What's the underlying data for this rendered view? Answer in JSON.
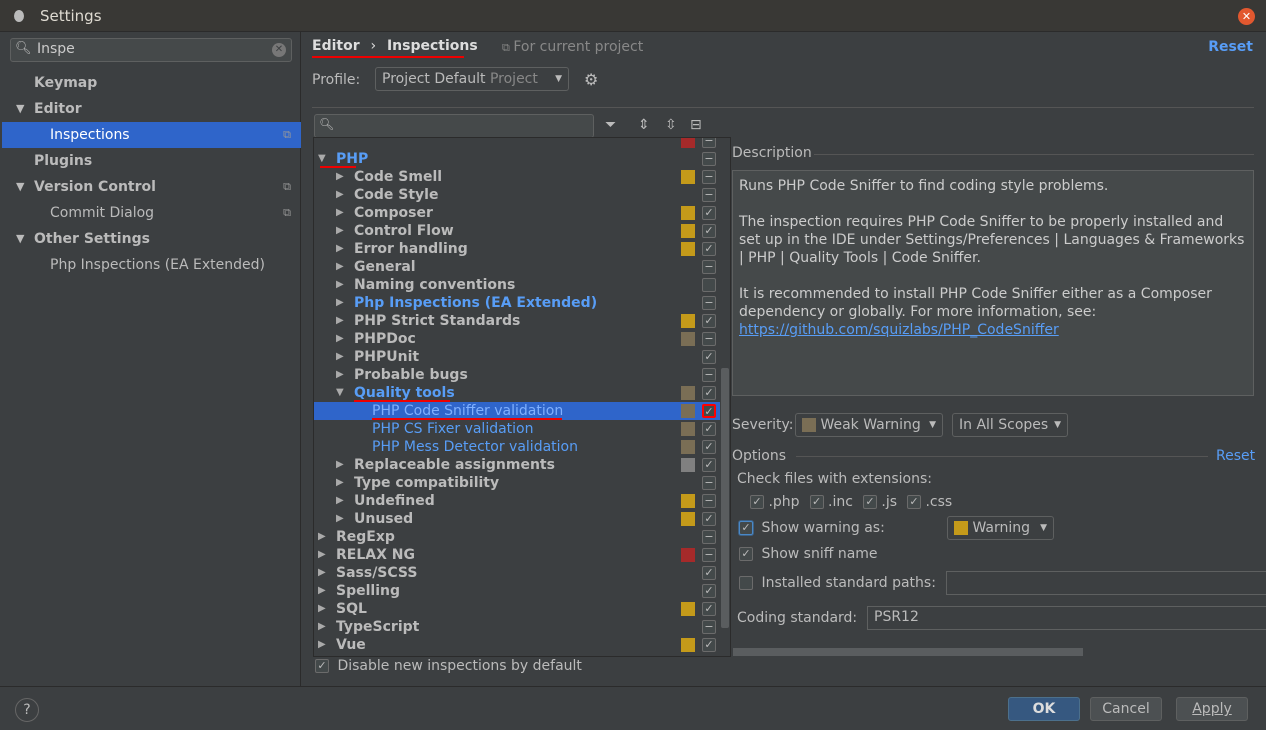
{
  "window": {
    "title": "Settings"
  },
  "search": {
    "value": "Inspe"
  },
  "sidebar": {
    "items": [
      {
        "label": "Keymap",
        "level": 0,
        "bold": true,
        "arrow": ""
      },
      {
        "label": "Editor",
        "level": 0,
        "bold": true,
        "arrow": "▼"
      },
      {
        "label": "Inspections",
        "level": 1,
        "bold": false,
        "arrow": "",
        "selected": true,
        "copy": true
      },
      {
        "label": "Plugins",
        "level": 0,
        "bold": true,
        "arrow": ""
      },
      {
        "label": "Version Control",
        "level": 0,
        "bold": true,
        "arrow": "▼",
        "copy": true
      },
      {
        "label": "Commit Dialog",
        "level": 1,
        "bold": false,
        "arrow": "",
        "copy": true
      },
      {
        "label": "Other Settings",
        "level": 0,
        "bold": true,
        "arrow": "▼"
      },
      {
        "label": "Php Inspections (EA Extended)",
        "level": 1,
        "bold": false,
        "arrow": ""
      }
    ]
  },
  "breadcrumb": {
    "parent": "Editor",
    "separator": "›",
    "current": "Inspections",
    "scope": "For current project",
    "reset": "Reset"
  },
  "profile": {
    "label": "Profile:",
    "value": "Project Default",
    "hint": "Project"
  },
  "tree": {
    "rows": [
      {
        "label": "",
        "level": 0,
        "exp": "",
        "color": "#a52a2a",
        "state": "mixed",
        "clipped": true
      },
      {
        "label": "PHP",
        "level": 0,
        "exp": "▼",
        "color": "",
        "state": "mixed",
        "bold": true,
        "blue": true
      },
      {
        "label": "Code Smell",
        "level": 1,
        "exp": "▶",
        "color": "#c49a1a",
        "state": "mixed",
        "bold": true
      },
      {
        "label": "Code Style",
        "level": 1,
        "exp": "▶",
        "color": "",
        "state": "mixed",
        "bold": true
      },
      {
        "label": "Composer",
        "level": 1,
        "exp": "▶",
        "color": "#c49a1a",
        "state": "checked",
        "bold": true
      },
      {
        "label": "Control Flow",
        "level": 1,
        "exp": "▶",
        "color": "#c49a1a",
        "state": "checked",
        "bold": true
      },
      {
        "label": "Error handling",
        "level": 1,
        "exp": "▶",
        "color": "#c49a1a",
        "state": "checked",
        "bold": true
      },
      {
        "label": "General",
        "level": 1,
        "exp": "▶",
        "color": "",
        "state": "mixed",
        "bold": true
      },
      {
        "label": "Naming conventions",
        "level": 1,
        "exp": "▶",
        "color": "",
        "state": "unchecked",
        "bold": true
      },
      {
        "label": "Php Inspections (EA Extended)",
        "level": 1,
        "exp": "▶",
        "color": "",
        "state": "mixed",
        "bold": true,
        "blue": true
      },
      {
        "label": "PHP Strict Standards",
        "level": 1,
        "exp": "▶",
        "color": "#c49a1a",
        "state": "checked",
        "bold": true
      },
      {
        "label": "PHPDoc",
        "level": 1,
        "exp": "▶",
        "color": "#7a6e55",
        "state": "mixed",
        "bold": true
      },
      {
        "label": "PHPUnit",
        "level": 1,
        "exp": "▶",
        "color": "",
        "state": "checked",
        "bold": true
      },
      {
        "label": "Probable bugs",
        "level": 1,
        "exp": "▶",
        "color": "",
        "state": "mixed",
        "bold": true
      },
      {
        "label": "Quality tools",
        "level": 1,
        "exp": "▼",
        "color": "#7a6e55",
        "state": "checked",
        "bold": true,
        "blue": true
      },
      {
        "label": "PHP Code Sniffer validation",
        "level": 2,
        "exp": "",
        "color": "#7a6e55",
        "state": "checked",
        "selected": true
      },
      {
        "label": "PHP CS Fixer validation",
        "level": 2,
        "exp": "",
        "color": "#7a6e55",
        "state": "checked",
        "blue": true
      },
      {
        "label": "PHP Mess Detector validation",
        "level": 2,
        "exp": "",
        "color": "#7a6e55",
        "state": "checked",
        "blue": true
      },
      {
        "label": "Replaceable assignments",
        "level": 1,
        "exp": "▶",
        "color": "#808080",
        "state": "checked",
        "bold": true
      },
      {
        "label": "Type compatibility",
        "level": 1,
        "exp": "▶",
        "color": "",
        "state": "mixed",
        "bold": true
      },
      {
        "label": "Undefined",
        "level": 1,
        "exp": "▶",
        "color": "#c49a1a",
        "state": "mixed",
        "bold": true
      },
      {
        "label": "Unused",
        "level": 1,
        "exp": "▶",
        "color": "#c49a1a",
        "state": "checked",
        "bold": true
      },
      {
        "label": "RegExp",
        "level": 0,
        "exp": "▶",
        "color": "",
        "state": "mixed",
        "bold": true
      },
      {
        "label": "RELAX NG",
        "level": 0,
        "exp": "▶",
        "color": "#a52a2a",
        "state": "mixed",
        "bold": true
      },
      {
        "label": "Sass/SCSS",
        "level": 0,
        "exp": "▶",
        "color": "",
        "state": "checked",
        "bold": true
      },
      {
        "label": "Spelling",
        "level": 0,
        "exp": "▶",
        "color": "",
        "state": "checked",
        "bold": true
      },
      {
        "label": "SQL",
        "level": 0,
        "exp": "▶",
        "color": "#c49a1a",
        "state": "checked",
        "bold": true
      },
      {
        "label": "TypeScript",
        "level": 0,
        "exp": "▶",
        "color": "",
        "state": "mixed",
        "bold": true
      },
      {
        "label": "Vue",
        "level": 0,
        "exp": "▶",
        "color": "#c49a1a",
        "state": "checked",
        "bold": true
      }
    ]
  },
  "disable_new": {
    "label": "Disable new inspections by default",
    "checked": true
  },
  "description": {
    "title": "Description",
    "p1": "Runs PHP Code Sniffer to find coding style problems.",
    "p2": "The inspection requires PHP Code Sniffer to be properly installed and set up in the IDE under Settings/Preferences | Languages & Frameworks | PHP | Quality Tools | Code Sniffer.",
    "p3": "It is recommended to install PHP Code Sniffer either as a Composer dependency or globally. For more information, see:",
    "link": "https://github.com/squizlabs/PHP_CodeSniffer"
  },
  "severity": {
    "label": "Severity:",
    "value": "Weak Warning",
    "color": "#7a6e55",
    "scope": "In All Scopes"
  },
  "options": {
    "title": "Options",
    "reset": "Reset",
    "ext_label": "Check files with extensions:",
    "extensions": [
      ".php",
      ".inc",
      ".js",
      ".css"
    ],
    "show_warning": "Show warning as:",
    "warning_value": "Warning",
    "warning_color": "#c49a1a",
    "show_sniff": "Show sniff name",
    "installed_paths": "Installed standard paths:",
    "coding_standard_label": "Coding standard:",
    "coding_standard": "PSR12"
  },
  "footer": {
    "help": "?",
    "ok": "OK",
    "cancel": "Cancel",
    "apply": "Apply"
  }
}
